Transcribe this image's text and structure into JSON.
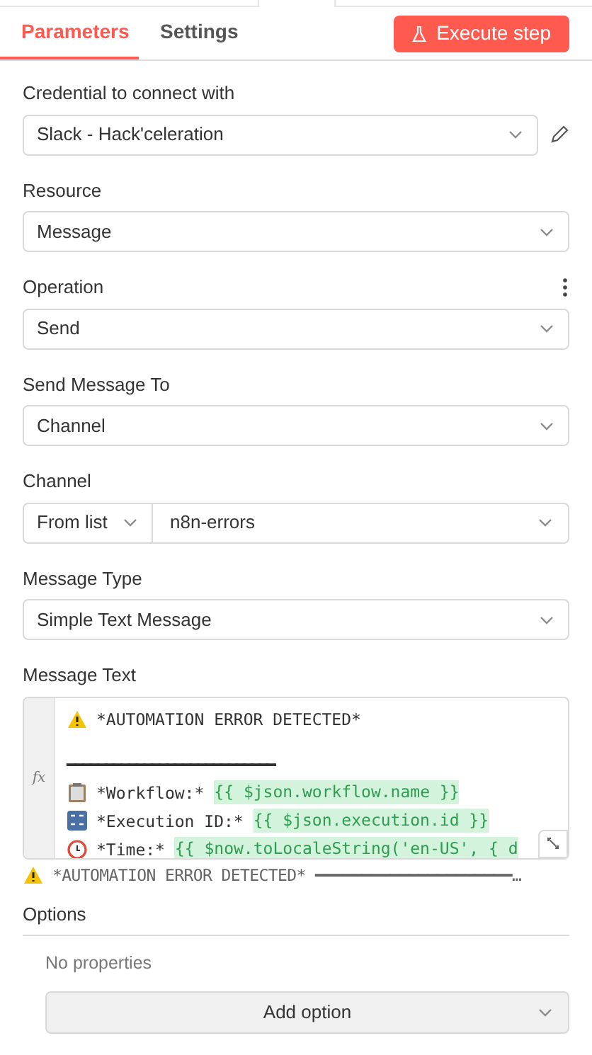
{
  "tabs": [
    {
      "label": "Parameters",
      "selected": true
    },
    {
      "label": "Settings",
      "selected": false
    }
  ],
  "execute_button": {
    "label": "Execute step"
  },
  "fields": [
    {
      "kind": "select",
      "label": "Credential to connect with",
      "value": "Slack - Hack'celeration",
      "editable": true,
      "menu": false
    },
    {
      "kind": "select",
      "label": "Resource",
      "value": "Message",
      "editable": false,
      "menu": false
    },
    {
      "kind": "select",
      "label": "Operation",
      "value": "Send",
      "editable": false,
      "menu": true
    },
    {
      "kind": "select",
      "label": "Send Message To",
      "value": "Channel",
      "editable": false,
      "menu": false
    },
    {
      "kind": "split",
      "label": "Channel",
      "mode": "From list",
      "value": "n8n-errors",
      "editable": false,
      "menu": false
    },
    {
      "kind": "select",
      "label": "Message Type",
      "value": "Simple Text Message",
      "editable": false,
      "menu": false
    }
  ],
  "message_text": {
    "label": "Message Text",
    "fx": "fx",
    "lines": [
      {
        "kind": "warning",
        "segments": [
          {
            "kind": "text",
            "text": "*AUTOMATION ERROR DETECTED*"
          }
        ]
      },
      {
        "kind": "divider",
        "segments": [
          {
            "kind": "text",
            "text": "━━━━━━━━━━━━━━━━━━━━━━━━━━━"
          }
        ]
      },
      {
        "kind": "clipboard",
        "segments": [
          {
            "kind": "text",
            "text": "*Workflow:*"
          },
          {
            "kind": "expression",
            "text": "{{ $json.workflow.name }}"
          }
        ]
      },
      {
        "kind": "counter",
        "segments": [
          {
            "kind": "text",
            "text": "*Execution ID:*"
          },
          {
            "kind": "expression",
            "text": "{{ $json.execution.id }}"
          }
        ]
      },
      {
        "kind": "clock",
        "segments": [
          {
            "kind": "text",
            "text": "*Time:*"
          },
          {
            "kind": "expression",
            "text": "{{ $now.toLocaleString('en-US', { d"
          }
        ]
      }
    ],
    "preview": "*AUTOMATION ERROR DETECTED* ━━━━━━━━━━━━━━━━━━━━━…"
  },
  "options": {
    "title": "Options",
    "empty_text": "No properties",
    "add_button": "Add option"
  }
}
